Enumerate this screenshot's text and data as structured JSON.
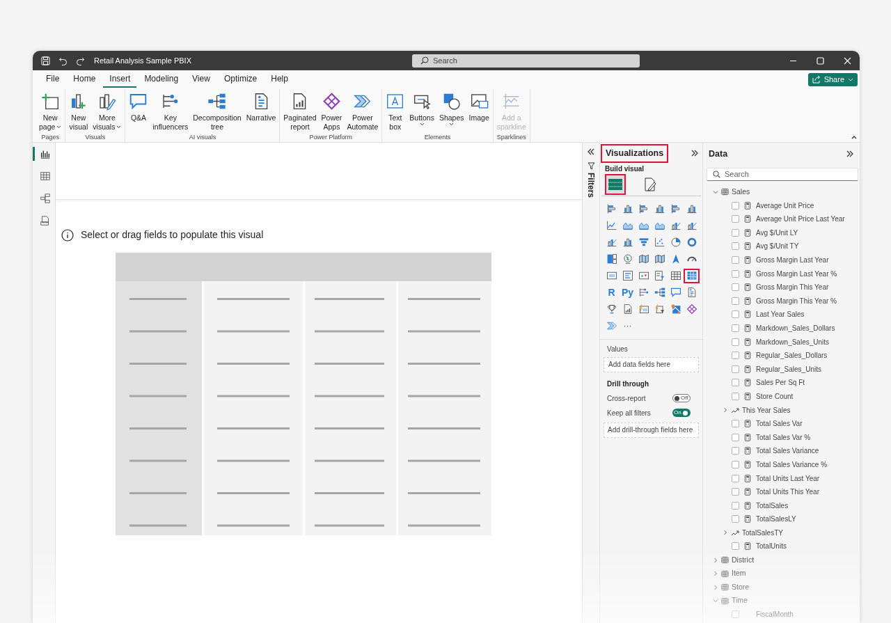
{
  "window": {
    "title": "Retail Analysis Sample PBIX",
    "search": {
      "placeholder": "Search"
    }
  },
  "menu": [
    {
      "label": "File",
      "selected": false
    },
    {
      "label": "Home",
      "selected": false
    },
    {
      "label": "Insert",
      "selected": true
    },
    {
      "label": "Modeling",
      "selected": false
    },
    {
      "label": "View",
      "selected": false
    },
    {
      "label": "Optimize",
      "selected": false
    },
    {
      "label": "Help",
      "selected": false
    }
  ],
  "share_button": {
    "label": "Share"
  },
  "ribbon": [
    {
      "name": "Pages",
      "items": [
        {
          "lines": [
            "New",
            "page"
          ],
          "dropdown": true,
          "disabled": false
        }
      ]
    },
    {
      "name": "Visuals",
      "items": [
        {
          "lines": [
            "New",
            "visual"
          ],
          "dropdown": false,
          "disabled": false
        },
        {
          "lines": [
            "More",
            "visuals"
          ],
          "dropdown": true,
          "disabled": false
        }
      ]
    },
    {
      "name": "AI visuals",
      "items": [
        {
          "lines": [
            "Q&A"
          ],
          "dropdown": false,
          "disabled": false
        },
        {
          "lines": [
            "Key",
            "influencers"
          ],
          "dropdown": false,
          "disabled": false
        },
        {
          "lines": [
            "Decomposition",
            "tree"
          ],
          "dropdown": false,
          "disabled": false
        },
        {
          "lines": [
            "Narrative"
          ],
          "dropdown": false,
          "disabled": false
        }
      ]
    },
    {
      "name": "Power Platform",
      "items": [
        {
          "lines": [
            "Paginated",
            "report"
          ],
          "dropdown": false,
          "disabled": false
        },
        {
          "lines": [
            "Power",
            "Apps"
          ],
          "dropdown": false,
          "disabled": false
        },
        {
          "lines": [
            "Power",
            "Automate"
          ],
          "dropdown": false,
          "disabled": false
        }
      ]
    },
    {
      "name": "Elements",
      "items": [
        {
          "lines": [
            "Text",
            "box"
          ],
          "dropdown": false,
          "disabled": false
        },
        {
          "lines": [
            "Buttons"
          ],
          "dropdown": true,
          "disabled": false
        },
        {
          "lines": [
            "Shapes"
          ],
          "dropdown": true,
          "disabled": false
        },
        {
          "lines": [
            "Image"
          ],
          "dropdown": false,
          "disabled": false
        }
      ]
    },
    {
      "name": "Sparklines",
      "items": [
        {
          "lines": [
            "Add a",
            "sparkline"
          ],
          "dropdown": false,
          "disabled": true
        }
      ]
    }
  ],
  "nav": [
    {
      "selected": true
    },
    {
      "selected": false
    },
    {
      "selected": false
    },
    {
      "selected": false
    }
  ],
  "canvas": {
    "message": "Select or drag fields to populate this visual"
  },
  "filters": {
    "label": "Filters"
  },
  "visualizations": {
    "title": "Visualizations",
    "highlighted": true,
    "subtitle": "Build visual",
    "build_tabs": [
      {
        "selected": true,
        "highlighted": true
      },
      {
        "selected": false,
        "highlighted": false
      }
    ],
    "gallery": [
      {
        "kind": "icon",
        "highlighted": false
      },
      {
        "kind": "icon",
        "highlighted": false
      },
      {
        "kind": "icon",
        "highlighted": false
      },
      {
        "kind": "icon",
        "highlighted": false
      },
      {
        "kind": "icon",
        "highlighted": false
      },
      {
        "kind": "icon",
        "highlighted": false
      },
      {
        "kind": "icon",
        "highlighted": false
      },
      {
        "kind": "icon",
        "highlighted": false
      },
      {
        "kind": "icon",
        "highlighted": false
      },
      {
        "kind": "icon",
        "highlighted": false
      },
      {
        "kind": "icon",
        "highlighted": false
      },
      {
        "kind": "icon",
        "highlighted": false
      },
      {
        "kind": "icon",
        "highlighted": false
      },
      {
        "kind": "icon",
        "highlighted": false
      },
      {
        "kind": "icon",
        "highlighted": false
      },
      {
        "kind": "icon",
        "highlighted": false
      },
      {
        "kind": "icon",
        "highlighted": false
      },
      {
        "kind": "icon",
        "highlighted": false
      },
      {
        "kind": "icon",
        "highlighted": false
      },
      {
        "kind": "icon",
        "highlighted": false
      },
      {
        "kind": "icon",
        "highlighted": false
      },
      {
        "kind": "icon",
        "highlighted": false
      },
      {
        "kind": "icon",
        "highlighted": false
      },
      {
        "kind": "icon",
        "highlighted": false
      },
      {
        "kind": "icon",
        "highlighted": false
      },
      {
        "kind": "icon",
        "highlighted": false
      },
      {
        "kind": "icon",
        "highlighted": false
      },
      {
        "kind": "icon",
        "highlighted": false
      },
      {
        "kind": "icon",
        "highlighted": false
      },
      {
        "kind": "icon",
        "highlighted": true
      },
      {
        "kind": "text",
        "label": "R",
        "highlighted": false
      },
      {
        "kind": "text",
        "label": "Py",
        "highlighted": false
      },
      {
        "kind": "icon",
        "highlighted": false
      },
      {
        "kind": "icon",
        "highlighted": false
      },
      {
        "kind": "icon",
        "highlighted": false
      },
      {
        "kind": "icon",
        "highlighted": false
      },
      {
        "kind": "icon",
        "highlighted": false
      },
      {
        "kind": "icon",
        "highlighted": false
      },
      {
        "kind": "icon",
        "highlighted": false
      },
      {
        "kind": "icon",
        "highlighted": false
      },
      {
        "kind": "icon",
        "highlighted": false
      },
      {
        "kind": "icon",
        "highlighted": false
      },
      {
        "kind": "icon",
        "highlighted": false
      },
      {
        "kind": "more",
        "label": "···",
        "highlighted": false
      }
    ],
    "values": {
      "label": "Values",
      "placeholder": "Add data fields here"
    },
    "drill_through": {
      "title": "Drill through",
      "toggles": [
        {
          "label": "Cross-report",
          "on": false,
          "state": "Off"
        },
        {
          "label": "Keep all filters",
          "on": true,
          "state": "On"
        }
      ],
      "placeholder": "Add drill-through fields here"
    }
  },
  "data": {
    "title": "Data",
    "search": {
      "placeholder": "Search"
    },
    "tables": [
      {
        "name": "Sales",
        "expanded": true,
        "children": [
          {
            "kind": "measure",
            "name": "Average Unit Price",
            "checked": false
          },
          {
            "kind": "measure",
            "name": "Average Unit Price Last Year",
            "checked": false
          },
          {
            "kind": "measure",
            "name": "Avg $/Unit LY",
            "checked": false
          },
          {
            "kind": "measure",
            "name": "Avg $/Unit TY",
            "checked": false
          },
          {
            "kind": "measure",
            "name": "Gross Margin Last Year",
            "checked": false
          },
          {
            "kind": "measure",
            "name": "Gross Margin Last Year %",
            "checked": false
          },
          {
            "kind": "measure",
            "name": "Gross Margin This Year",
            "checked": false
          },
          {
            "kind": "measure",
            "name": "Gross Margin This Year %",
            "checked": false
          },
          {
            "kind": "measure",
            "name": "Last Year Sales",
            "checked": false
          },
          {
            "kind": "measure",
            "name": "Markdown_Sales_Dollars",
            "checked": false
          },
          {
            "kind": "measure",
            "name": "Markdown_Sales_Units",
            "checked": false
          },
          {
            "kind": "measure",
            "name": "Regular_Sales_Dollars",
            "checked": false
          },
          {
            "kind": "measure",
            "name": "Regular_Sales_Units",
            "checked": false
          },
          {
            "kind": "measure",
            "name": "Sales Per Sq Ft",
            "checked": false
          },
          {
            "kind": "measure",
            "name": "Store Count",
            "checked": false
          },
          {
            "kind": "kpi",
            "name": "This Year Sales",
            "expanded": false
          },
          {
            "kind": "measure",
            "name": "Total Sales Var",
            "checked": false
          },
          {
            "kind": "measure",
            "name": "Total Sales Var %",
            "checked": false
          },
          {
            "kind": "measure",
            "name": "Total Sales Variance",
            "checked": false
          },
          {
            "kind": "measure",
            "name": "Total Sales Variance %",
            "checked": false
          },
          {
            "kind": "measure",
            "name": "Total Units Last Year",
            "checked": false
          },
          {
            "kind": "measure",
            "name": "Total Units This Year",
            "checked": false
          },
          {
            "kind": "measure",
            "name": "TotalSales",
            "checked": false
          },
          {
            "kind": "measure",
            "name": "TotalSalesLY",
            "checked": false
          },
          {
            "kind": "kpi",
            "name": "TotalSalesTY",
            "expanded": false
          },
          {
            "kind": "measure",
            "name": "TotalUnits",
            "checked": false
          }
        ]
      },
      {
        "name": "District",
        "expanded": false
      },
      {
        "name": "Item",
        "expanded": false
      },
      {
        "name": "Store",
        "expanded": false
      },
      {
        "name": "Time",
        "expanded": true,
        "children": [
          {
            "kind": "column",
            "name": "FiscalMonth",
            "checked": false
          }
        ]
      }
    ]
  }
}
